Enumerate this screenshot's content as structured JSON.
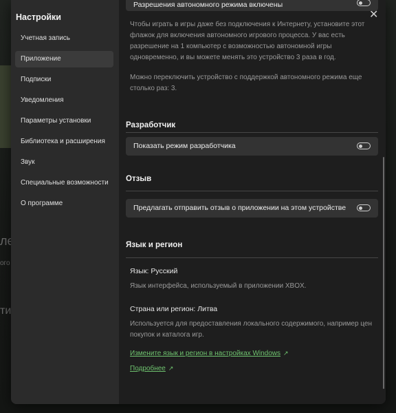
{
  "background": {
    "fragments": [
      "ле",
      "ого",
      "ти"
    ]
  },
  "sidebar": {
    "title": "Настройки",
    "items": [
      {
        "label": "Учетная запись"
      },
      {
        "label": "Приложение",
        "active": true
      },
      {
        "label": "Подписки"
      },
      {
        "label": "Уведомления"
      },
      {
        "label": "Параметры установки"
      },
      {
        "label": "Библиотека и расширения"
      },
      {
        "label": "Звук"
      },
      {
        "label": "Специальные возможности"
      },
      {
        "label": "О программе"
      }
    ]
  },
  "offline": {
    "toggle_label": "Разрешения автономного режима включены",
    "description": "Чтобы играть в игры даже без подключения к Интернету, установите этот флажок для включения автономного игрового процесса. У вас есть разрешение на 1 компьютер с возможностью автономной игры одновременно, и вы можете менять это устройство 3 раза в год.",
    "switch_note": "Можно переключить устройство с поддержкой автономного режима еще столько раз: 3."
  },
  "developer": {
    "heading": "Разработчик",
    "toggle_label": "Показать режим разработчика"
  },
  "feedback": {
    "heading": "Отзыв",
    "toggle_label": "Предлагать отправить отзыв о приложении на этом устройстве"
  },
  "language": {
    "heading": "Язык и регион",
    "language_label": "Язык: Русский",
    "language_desc": "Язык интерфейса, используемый в приложении XBOX.",
    "region_label": "Страна или регион: Литва",
    "region_desc": "Используется для предоставления локального содержимого, например цен покупок и каталога игр.",
    "windows_link": "Измените язык и регион в настройках Windows",
    "more_link": "Подробнее"
  },
  "colors": {
    "accent_link": "#6fc36f",
    "panel": "#1e1e1e",
    "sidebar": "#2b2b2b"
  },
  "icons": {
    "close": "close-icon",
    "external": "external-link-icon"
  }
}
